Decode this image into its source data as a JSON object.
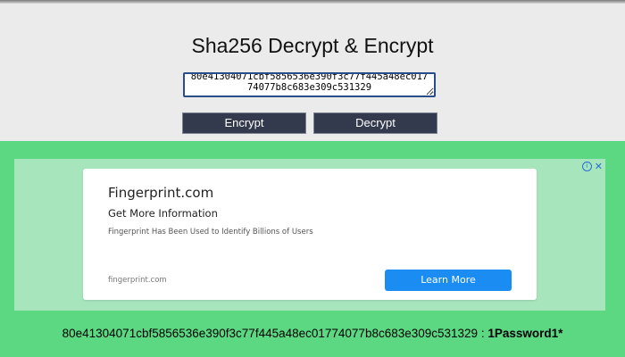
{
  "header": {
    "title": "Sha256 Decrypt & Encrypt"
  },
  "input": {
    "value": "80e41304071cbf5856536e390f3c77f445a48ec01774077b8c683e309c531329"
  },
  "buttons": {
    "encrypt_label": "Encrypt",
    "decrypt_label": "Decrypt"
  },
  "ad": {
    "brand": "Fingerprint.com",
    "headline": "Get More Information",
    "body": "Fingerprint Has Been Used to Identify Billions of Users",
    "domain": "fingerprint.com",
    "cta_label": "Learn More",
    "info_glyph": "i",
    "close_glyph": "✕"
  },
  "result": {
    "hash": "80e41304071cbf5856536e390f3c77f445a48ec01774077b8c683e309c531329",
    "separator": " : ",
    "plaintext": "1Password1*"
  },
  "colors": {
    "header_bg": "#ebebeb",
    "green_bg": "#5cd882",
    "button_bg": "#343a4e",
    "cta_bg": "#1a8cf2"
  }
}
